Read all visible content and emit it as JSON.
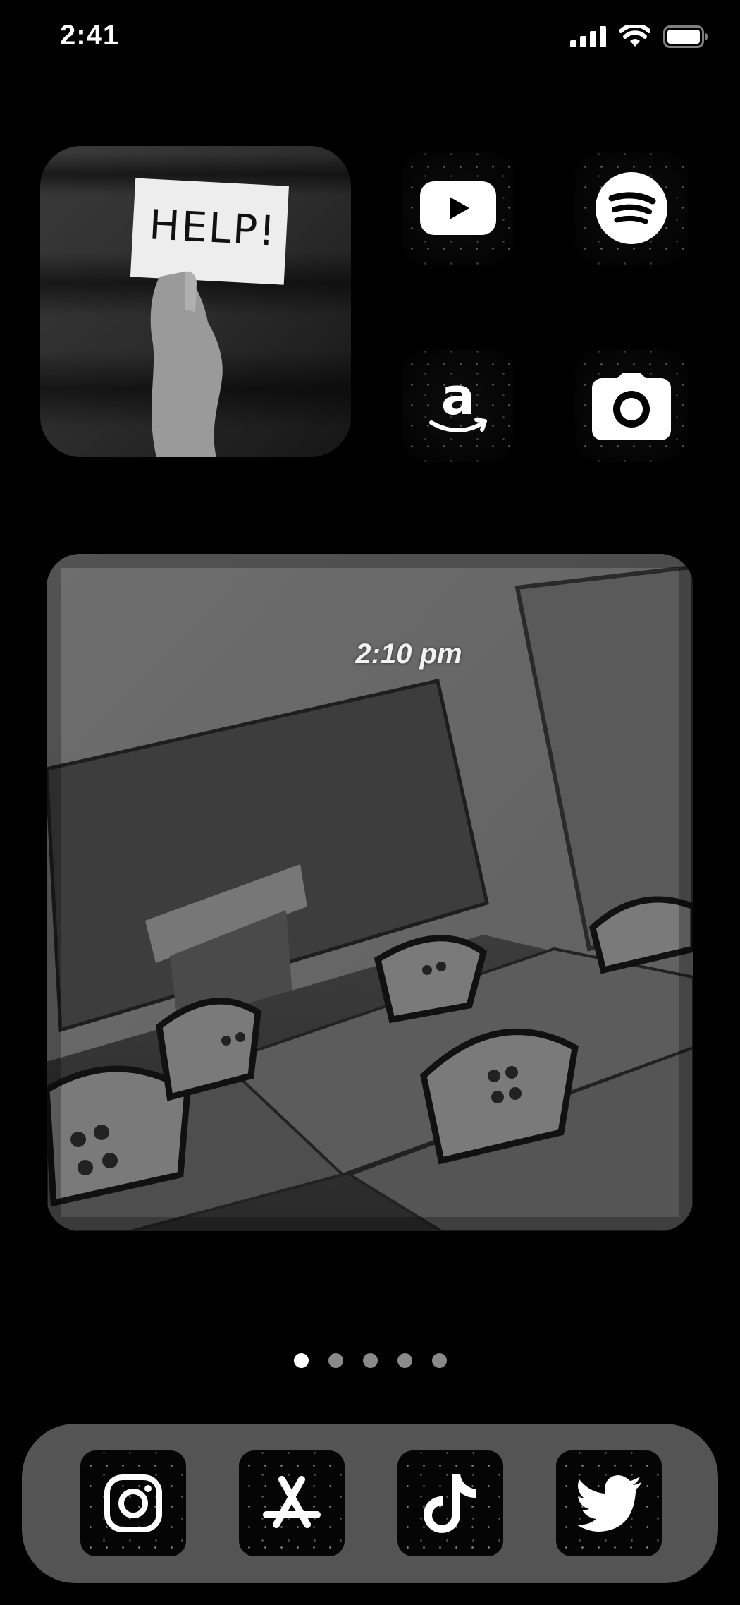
{
  "status_bar": {
    "time": "2:41"
  },
  "photo_widget": {
    "card_text": "HELP!"
  },
  "apps": [
    {
      "name": "YouTube",
      "icon": "youtube-icon"
    },
    {
      "name": "Spotify",
      "icon": "spotify-icon"
    },
    {
      "name": "Amazon",
      "icon": "amazon-icon"
    },
    {
      "name": "Camera",
      "icon": "camera-icon"
    }
  ],
  "clock_widget": {
    "time": "2:10 pm"
  },
  "page_dots": {
    "count": 5,
    "active_index": 0
  },
  "dock": [
    {
      "name": "Instagram",
      "icon": "instagram-icon"
    },
    {
      "name": "App Store",
      "icon": "app-store-icon"
    },
    {
      "name": "TikTok",
      "icon": "tiktok-icon"
    },
    {
      "name": "Twitter",
      "icon": "twitter-icon"
    }
  ],
  "colors": {
    "background": "#000000",
    "dock": "#545454",
    "icon_glyph": "#ffffff",
    "inactive_dot": "#8a8a8a"
  }
}
